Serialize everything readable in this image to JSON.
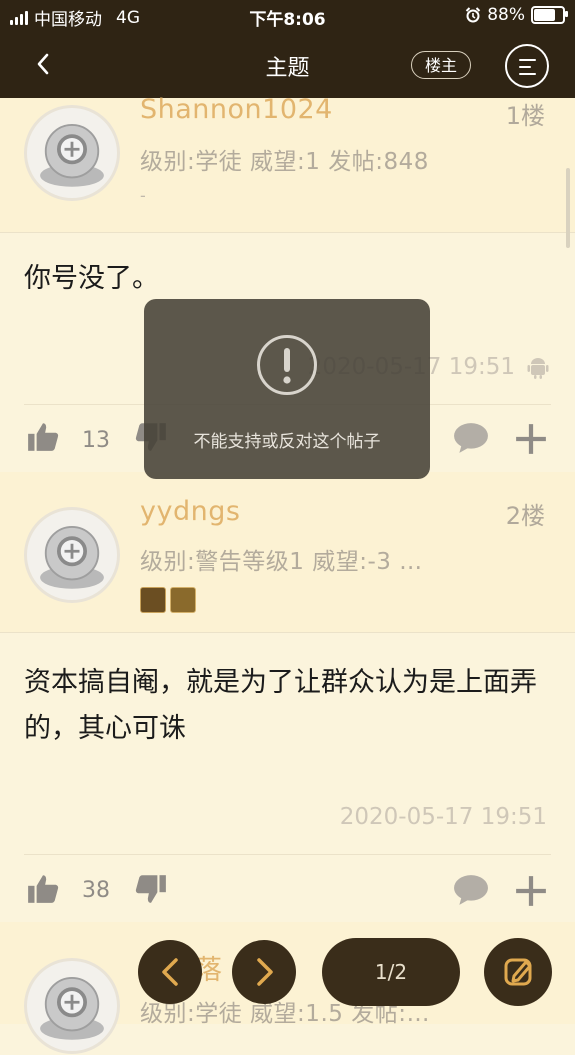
{
  "status_bar": {
    "carrier": "中国移动",
    "network": "4G",
    "time": "下午8:06",
    "battery_percent": "88%",
    "battery_level": 0.88
  },
  "nav": {
    "title": "主题",
    "owner_label": "楼主"
  },
  "posts": [
    {
      "username": "Shannon1024",
      "floor": "1楼",
      "meta": "级别:学徒  威望:1  发帖:848",
      "dash": "-",
      "content": "你号没了。",
      "timestamp": "2020-05-17 19:51",
      "likes": "13",
      "device": "android-icon"
    },
    {
      "username": "yydngs",
      "floor": "2楼",
      "meta": "级别:警告等级1  威望:-3  …",
      "content": "资本搞自阉，就是为了让群众认为是上面弄的，其心可诛",
      "timestamp": "2020-05-17 19:51",
      "likes": "38"
    },
    {
      "username": "雪花落",
      "meta": "级别:学徒  威望:1.5  发帖:…"
    }
  ],
  "toast": {
    "message": "不能支持或反对这个帖子",
    "icon": "exclamation-circle-icon"
  },
  "bottom_bar": {
    "pager": "1/2",
    "prev_icon": "chevron-left-icon",
    "next_icon": "chevron-right-icon",
    "compose_icon": "edit-icon"
  },
  "colors": {
    "nav_bg": "#2f2414",
    "username": "#e2b56f",
    "page_bg": "#fbf4dc",
    "accent": "#e0a94f"
  }
}
